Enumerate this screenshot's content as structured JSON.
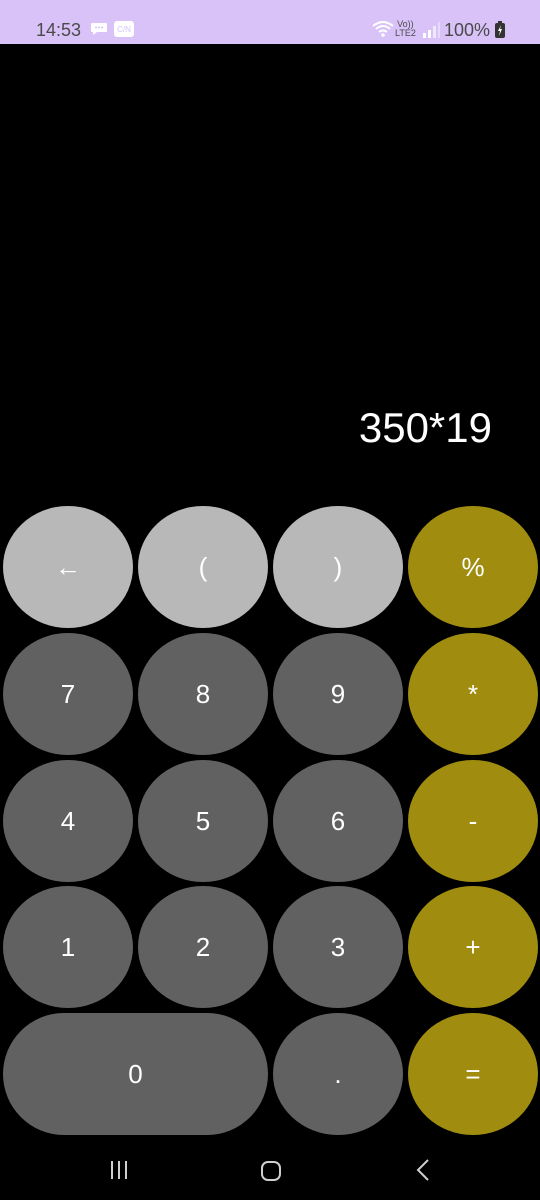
{
  "status_bar": {
    "time": "14:53",
    "network_label_top": "Vo))",
    "network_label_bottom": "LTE2",
    "battery": "100%",
    "app_badge": "C/N",
    "background": "#d8c2f8"
  },
  "display": {
    "expression": "350*19"
  },
  "keypad": {
    "backspace": "←",
    "open_paren": "(",
    "close_paren": ")",
    "percent": "%",
    "seven": "7",
    "eight": "8",
    "nine": "9",
    "multiply": "*",
    "four": "4",
    "five": "5",
    "six": "6",
    "minus": "-",
    "one": "1",
    "two": "2",
    "three": "3",
    "plus": "+",
    "zero": "0",
    "dot": ".",
    "equals": "="
  },
  "colors": {
    "function_key": "#b8b8b8",
    "digit_key": "#616161",
    "operator_key": "#a08c0f",
    "background": "#000000"
  },
  "icons": {
    "status": [
      "chat-icon",
      "app-icon",
      "wifi-icon",
      "signal-icon",
      "battery-icon"
    ],
    "nav": [
      "recents-icon",
      "home-icon",
      "back-icon"
    ]
  }
}
